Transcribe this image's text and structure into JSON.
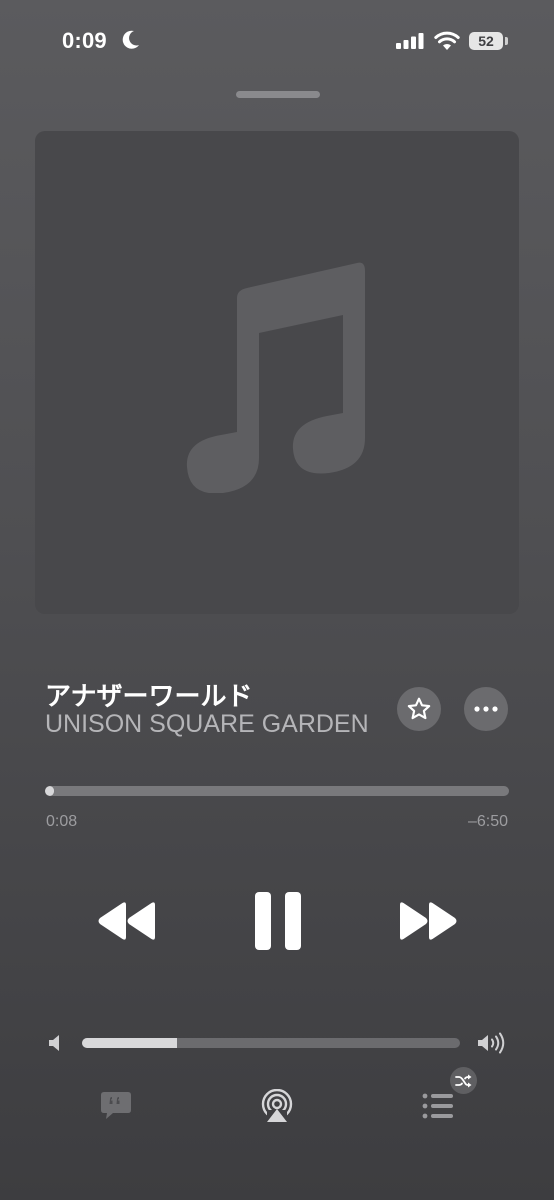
{
  "status_bar": {
    "time": "0:09",
    "battery_level": "52",
    "moon_icon": "moon-icon",
    "signal_icon": "cellular-signal-icon",
    "wifi_icon": "wifi-icon"
  },
  "now_playing": {
    "artwork_placeholder_icon": "music-note-icon",
    "title": "アナザーワールド",
    "artist": "UNISON SQUARE GARDEN",
    "favorite_icon": "star-icon",
    "more_icon": "ellipsis-icon"
  },
  "progress": {
    "elapsed": "0:08",
    "remaining": "–6:50",
    "fraction": 0.02
  },
  "controls": {
    "rewind_icon": "rewind-icon",
    "pause_icon": "pause-icon",
    "forward_icon": "fast-forward-icon"
  },
  "volume": {
    "level": 0.25,
    "low_icon": "speaker-low-icon",
    "high_icon": "speaker-high-icon"
  },
  "bottom_bar": {
    "lyrics_icon": "lyrics-quote-icon",
    "airplay_icon": "airplay-audio-icon",
    "queue_icon": "queue-list-icon",
    "shuffle_badge_icon": "shuffle-icon"
  },
  "colors": {
    "background_top": "#5b5b5e",
    "background_bottom": "#3d3d40",
    "artwork_bg": "#48484b",
    "track_fill": "#d8d8da",
    "secondary_text": "#b5b5b8"
  }
}
